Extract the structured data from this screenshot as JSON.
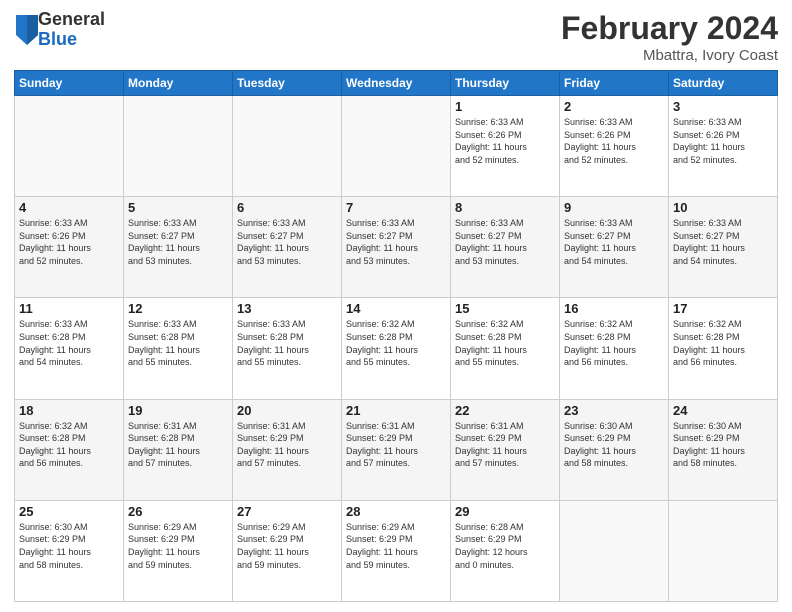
{
  "header": {
    "logo_general": "General",
    "logo_blue": "Blue",
    "title": "February 2024",
    "location": "Mbattra, Ivory Coast"
  },
  "days_of_week": [
    "Sunday",
    "Monday",
    "Tuesday",
    "Wednesday",
    "Thursday",
    "Friday",
    "Saturday"
  ],
  "weeks": [
    {
      "days": [
        {
          "number": "",
          "info": ""
        },
        {
          "number": "",
          "info": ""
        },
        {
          "number": "",
          "info": ""
        },
        {
          "number": "",
          "info": ""
        },
        {
          "number": "1",
          "info": "Sunrise: 6:33 AM\nSunset: 6:26 PM\nDaylight: 11 hours\nand 52 minutes."
        },
        {
          "number": "2",
          "info": "Sunrise: 6:33 AM\nSunset: 6:26 PM\nDaylight: 11 hours\nand 52 minutes."
        },
        {
          "number": "3",
          "info": "Sunrise: 6:33 AM\nSunset: 6:26 PM\nDaylight: 11 hours\nand 52 minutes."
        }
      ]
    },
    {
      "days": [
        {
          "number": "4",
          "info": "Sunrise: 6:33 AM\nSunset: 6:26 PM\nDaylight: 11 hours\nand 52 minutes."
        },
        {
          "number": "5",
          "info": "Sunrise: 6:33 AM\nSunset: 6:27 PM\nDaylight: 11 hours\nand 53 minutes."
        },
        {
          "number": "6",
          "info": "Sunrise: 6:33 AM\nSunset: 6:27 PM\nDaylight: 11 hours\nand 53 minutes."
        },
        {
          "number": "7",
          "info": "Sunrise: 6:33 AM\nSunset: 6:27 PM\nDaylight: 11 hours\nand 53 minutes."
        },
        {
          "number": "8",
          "info": "Sunrise: 6:33 AM\nSunset: 6:27 PM\nDaylight: 11 hours\nand 53 minutes."
        },
        {
          "number": "9",
          "info": "Sunrise: 6:33 AM\nSunset: 6:27 PM\nDaylight: 11 hours\nand 54 minutes."
        },
        {
          "number": "10",
          "info": "Sunrise: 6:33 AM\nSunset: 6:27 PM\nDaylight: 11 hours\nand 54 minutes."
        }
      ]
    },
    {
      "days": [
        {
          "number": "11",
          "info": "Sunrise: 6:33 AM\nSunset: 6:28 PM\nDaylight: 11 hours\nand 54 minutes."
        },
        {
          "number": "12",
          "info": "Sunrise: 6:33 AM\nSunset: 6:28 PM\nDaylight: 11 hours\nand 55 minutes."
        },
        {
          "number": "13",
          "info": "Sunrise: 6:33 AM\nSunset: 6:28 PM\nDaylight: 11 hours\nand 55 minutes."
        },
        {
          "number": "14",
          "info": "Sunrise: 6:32 AM\nSunset: 6:28 PM\nDaylight: 11 hours\nand 55 minutes."
        },
        {
          "number": "15",
          "info": "Sunrise: 6:32 AM\nSunset: 6:28 PM\nDaylight: 11 hours\nand 55 minutes."
        },
        {
          "number": "16",
          "info": "Sunrise: 6:32 AM\nSunset: 6:28 PM\nDaylight: 11 hours\nand 56 minutes."
        },
        {
          "number": "17",
          "info": "Sunrise: 6:32 AM\nSunset: 6:28 PM\nDaylight: 11 hours\nand 56 minutes."
        }
      ]
    },
    {
      "days": [
        {
          "number": "18",
          "info": "Sunrise: 6:32 AM\nSunset: 6:28 PM\nDaylight: 11 hours\nand 56 minutes."
        },
        {
          "number": "19",
          "info": "Sunrise: 6:31 AM\nSunset: 6:28 PM\nDaylight: 11 hours\nand 57 minutes."
        },
        {
          "number": "20",
          "info": "Sunrise: 6:31 AM\nSunset: 6:29 PM\nDaylight: 11 hours\nand 57 minutes."
        },
        {
          "number": "21",
          "info": "Sunrise: 6:31 AM\nSunset: 6:29 PM\nDaylight: 11 hours\nand 57 minutes."
        },
        {
          "number": "22",
          "info": "Sunrise: 6:31 AM\nSunset: 6:29 PM\nDaylight: 11 hours\nand 57 minutes."
        },
        {
          "number": "23",
          "info": "Sunrise: 6:30 AM\nSunset: 6:29 PM\nDaylight: 11 hours\nand 58 minutes."
        },
        {
          "number": "24",
          "info": "Sunrise: 6:30 AM\nSunset: 6:29 PM\nDaylight: 11 hours\nand 58 minutes."
        }
      ]
    },
    {
      "days": [
        {
          "number": "25",
          "info": "Sunrise: 6:30 AM\nSunset: 6:29 PM\nDaylight: 11 hours\nand 58 minutes."
        },
        {
          "number": "26",
          "info": "Sunrise: 6:29 AM\nSunset: 6:29 PM\nDaylight: 11 hours\nand 59 minutes."
        },
        {
          "number": "27",
          "info": "Sunrise: 6:29 AM\nSunset: 6:29 PM\nDaylight: 11 hours\nand 59 minutes."
        },
        {
          "number": "28",
          "info": "Sunrise: 6:29 AM\nSunset: 6:29 PM\nDaylight: 11 hours\nand 59 minutes."
        },
        {
          "number": "29",
          "info": "Sunrise: 6:28 AM\nSunset: 6:29 PM\nDaylight: 12 hours\nand 0 minutes."
        },
        {
          "number": "",
          "info": ""
        },
        {
          "number": "",
          "info": ""
        }
      ]
    }
  ]
}
